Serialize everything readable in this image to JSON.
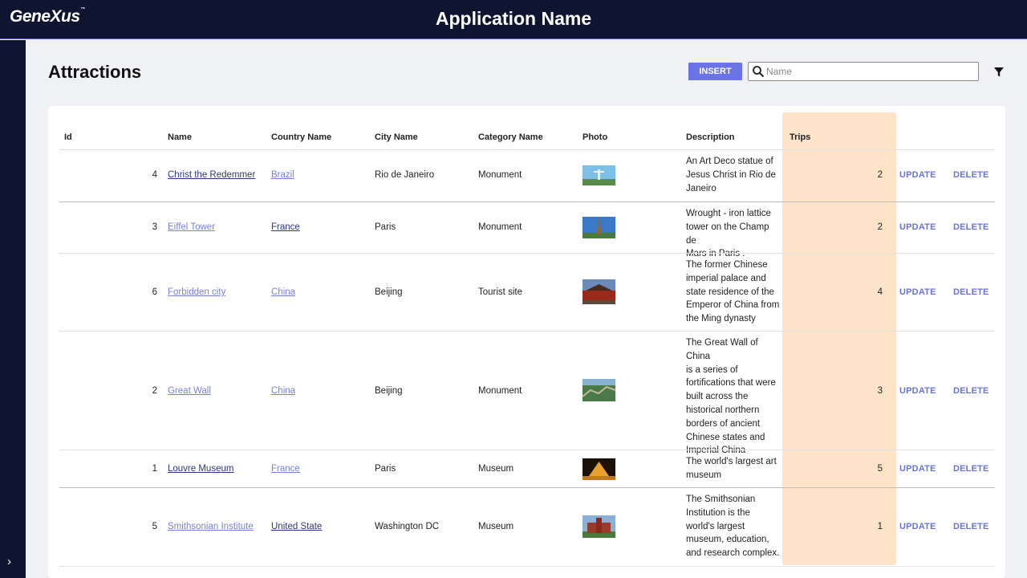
{
  "app": {
    "logo": "GeneXus",
    "logo_mark": "™",
    "title": "Application Name"
  },
  "page": {
    "title": "Attractions"
  },
  "toolbar": {
    "insert_label": "INSERT",
    "search_placeholder": "Name",
    "search_value": ""
  },
  "table": {
    "headers": {
      "id": "Id",
      "name": "Name",
      "country": "Country Name",
      "city": "City Name",
      "category": "Category Name",
      "photo": "Photo",
      "description": "Description",
      "trips": "Trips"
    },
    "update_label": "UPDATE",
    "delete_label": "DELETE",
    "rows": [
      {
        "id": "4",
        "name": "Christ the Redemmer",
        "country": "Brazil",
        "city": "Rio de Janeiro",
        "category": "Monument",
        "desc_lines": [
          "An Art Deco statue of",
          "Jesus Christ in Rio de",
          "Janeiro"
        ],
        "trips": "2"
      },
      {
        "id": "3",
        "name": "Eiffel Tower",
        "country": "France",
        "city": "Paris",
        "category": "Monument",
        "desc_lines": [
          "Wrought - iron lattice",
          "tower on the Champ de",
          "Mars in Paris ."
        ],
        "trips": "2"
      },
      {
        "id": "6",
        "name": "Forbidden city",
        "country": "China",
        "city": "Beijing",
        "category": "Tourist site",
        "desc_lines": [
          "The former Chinese",
          "imperial palace and",
          "state residence of the",
          "Emperor of China from",
          "the Ming dynasty"
        ],
        "trips": "4"
      },
      {
        "id": "2",
        "name": "Great Wall",
        "country": "China",
        "city": "Beijing",
        "category": "Monument",
        "desc_lines": [
          "The Great Wall of China",
          "is a series of",
          "fortifications that were",
          "built across the",
          "historical northern",
          "borders of ancient",
          "Chinese states and",
          "Imperial China"
        ],
        "trips": "3"
      },
      {
        "id": "1",
        "name": "Louvre Museum",
        "country": "France",
        "city": "Paris",
        "category": "Museum",
        "desc_lines": [
          "The world's largest art",
          "museum"
        ],
        "trips": "5"
      },
      {
        "id": "5",
        "name": "Smithsonian Institute",
        "country": "United State",
        "city": "Washington DC",
        "category": "Museum",
        "desc_lines": [
          "The Smithsonian",
          "Institution is the",
          "world's largest",
          "museum, education,",
          "and research complex."
        ],
        "trips": "1"
      }
    ]
  },
  "colors": {
    "topbar": "#0f1530",
    "accent": "#6b73e8",
    "trips_highlight": "#fde3c8",
    "link_dark": "#2f3580",
    "link_visited": "#7a7fdc"
  },
  "icons": {
    "search": "search-icon",
    "filter": "filter-icon",
    "sidebar_toggle": "chevron-right-icon"
  }
}
